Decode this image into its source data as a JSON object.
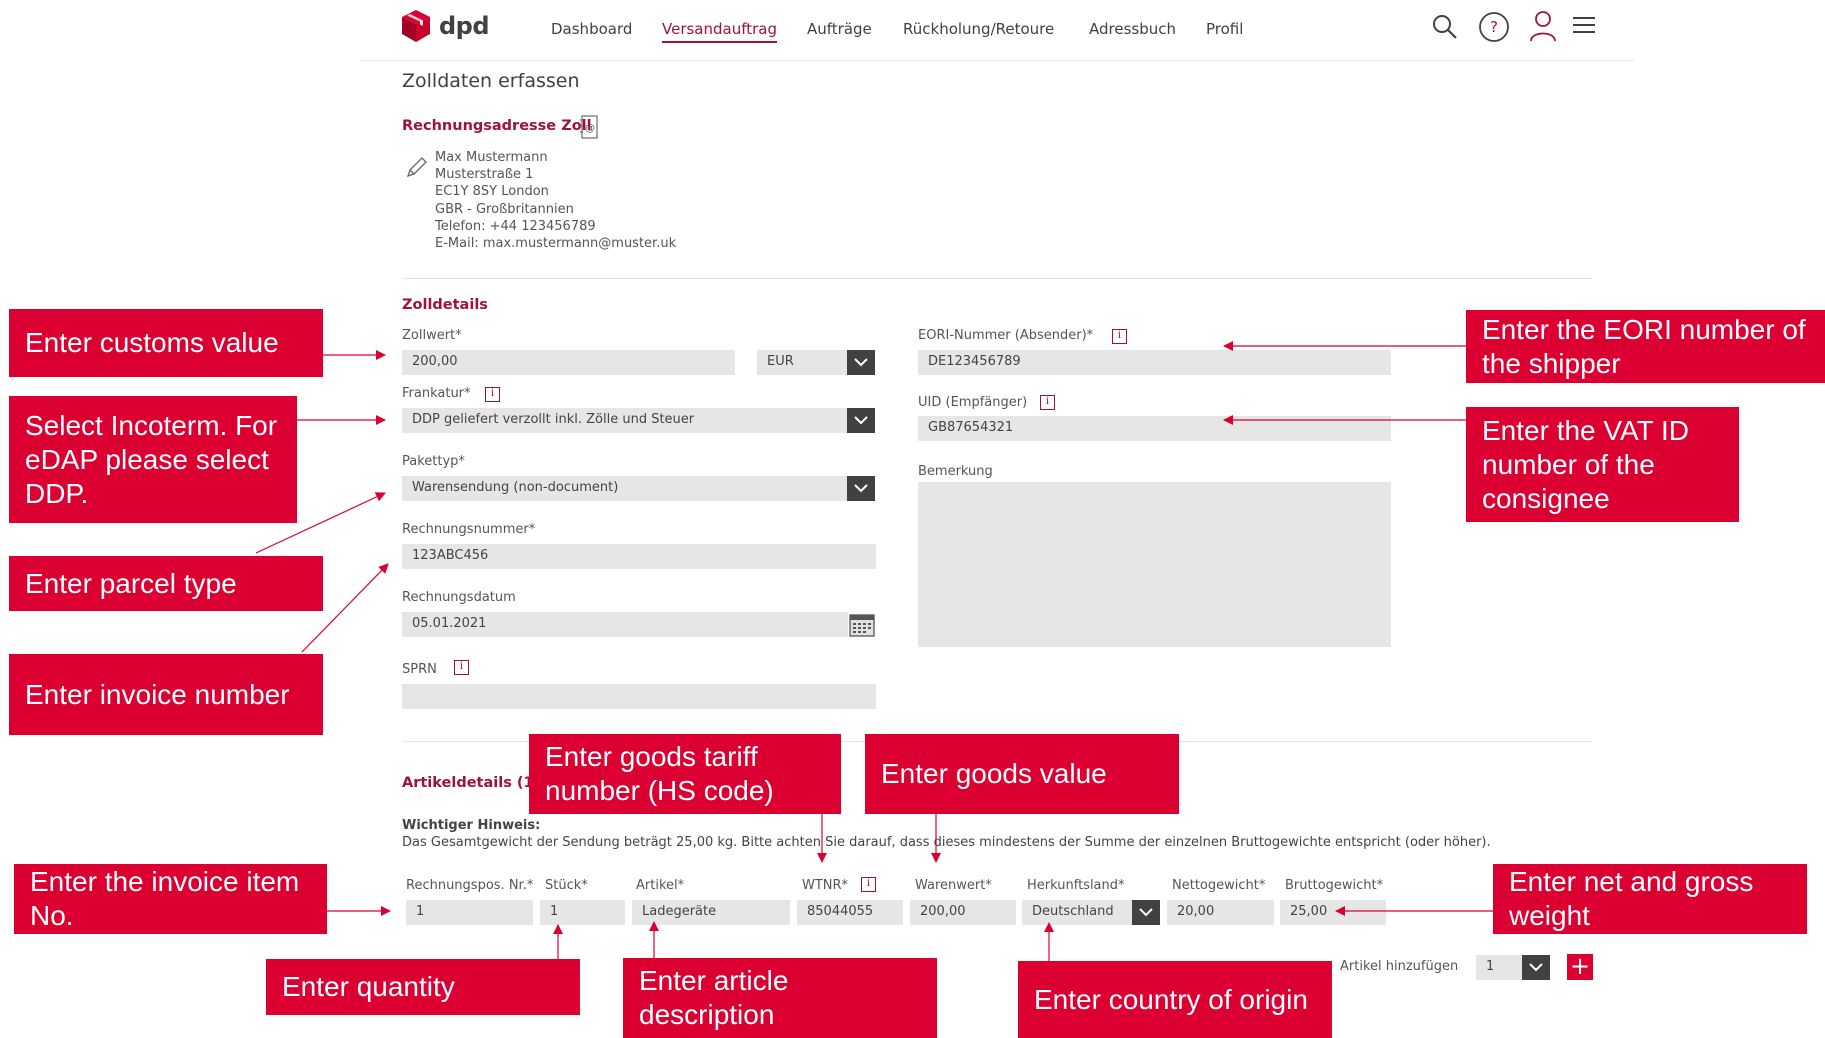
{
  "header": {
    "brand": "dpd",
    "nav": [
      "Dashboard",
      "Versandauftrag",
      "Aufträge",
      "Rückholung/Retoure",
      "Adressbuch",
      "Profil"
    ],
    "active_nav": "Versandauftrag",
    "icons": [
      "search-icon",
      "help-icon",
      "user-icon",
      "menu-icon"
    ],
    "accent": "#a0123a",
    "brand_red": "#dc0032"
  },
  "page_title": "Zolldaten erfassen",
  "billing": {
    "title": "Rechnungsadresse Zoll",
    "lines": [
      "Max Mustermann",
      "Musterstraße 1",
      "EC1Y 8SY London",
      "GBR - Großbritannien",
      "Telefon: +44 123456789",
      "E-Mail: max.mustermann@muster.uk"
    ]
  },
  "customs": {
    "title": "Zolldetails",
    "zollwert_label": "Zollwert*",
    "zollwert_value": "200,00",
    "currency": "EUR",
    "frankatur_label": "Frankatur*",
    "frankatur_value": "DDP geliefert verzollt inkl. Zölle und Steuer",
    "pakettyp_label": "Pakettyp*",
    "pakettyp_value": "Warensendung (non-document)",
    "rechnungsnummer_label": "Rechnungsnummer*",
    "rechnungsnummer_value": "123ABC456",
    "rechnungsdatum_label": "Rechnungsdatum",
    "rechnungsdatum_value": "05.01.2021",
    "sprn_label": "SPRN",
    "sprn_value": "",
    "eori_label": "EORI-Nummer (Absender)*",
    "eori_value": "DE123456789",
    "uid_label": "UID (Empfänger)",
    "uid_value": "GB87654321",
    "bemerkung_label": "Bemerkung",
    "bemerkung_value": ""
  },
  "articles": {
    "title": "Artikeldetails (1)",
    "notice_title": "Wichtiger Hinweis:",
    "notice_text": "Das Gesamtgewicht der Sendung beträgt 25,00 kg. Bitte achten Sie darauf, dass dieses mindestens der Summe der einzelnen Bruttogewichte entspricht (oder höher).",
    "columns": [
      "Rechnungspos. Nr.*",
      "Stück*",
      "Artikel*",
      "WTNR*",
      "Warenwert*",
      "Herkunftsland*",
      "Nettogewicht*",
      "Bruttogewicht*"
    ],
    "row": [
      "1",
      "1",
      "Ladegeräte",
      "85044055",
      "200,00",
      "Deutschland",
      "20,00",
      "25,00"
    ],
    "add_label": "Artikel hinzufügen",
    "add_count": "1",
    "add_button": "+"
  },
  "callouts": {
    "customs_value": "Enter customs value",
    "incoterm": "Select Incoterm. For eDAP please select DDP.",
    "parcel_type": "Enter parcel type",
    "invoice_number": "Enter invoice number",
    "eori": "Enter the EORI number of the shipper",
    "vat_id": "Enter the VAT ID number of the consignee",
    "hs_code": "Enter goods tariff number (HS code)",
    "goods_value": "Enter goods value",
    "invoice_item": "Enter the invoice item No.",
    "weight": "Enter net and gross weight",
    "quantity": "Enter quantity",
    "article_description": "Enter article description",
    "country": "Enter country of origin"
  }
}
